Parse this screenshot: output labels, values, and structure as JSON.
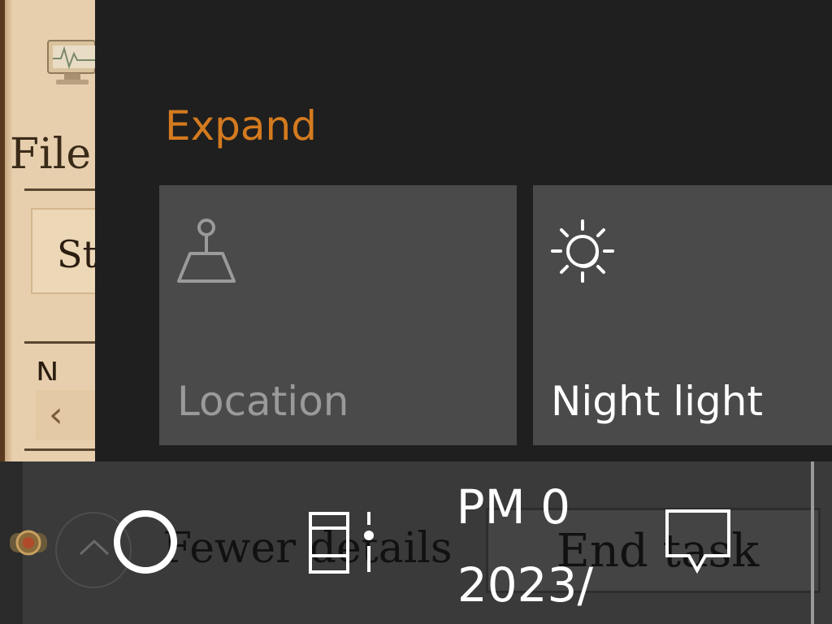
{
  "background_app": {
    "menu_file": "File",
    "tab_label": "St",
    "column_label": "N"
  },
  "action_center": {
    "expand_label": "Expand",
    "tiles": [
      {
        "label": "Location",
        "icon": "location-icon",
        "state": "off"
      },
      {
        "label": "Night light",
        "icon": "night-light-icon",
        "state": "on"
      }
    ]
  },
  "task_manager_footer": {
    "fewer_details_label": "Fewer details",
    "end_task_label": "End task"
  },
  "taskbar": {
    "clock_time": "0 PM",
    "clock_date": "/2023"
  },
  "colors": {
    "accent": "#d47a1f",
    "tile_bg": "#4a4a4a",
    "panel_bg": "#1f1f1f",
    "taskbar_bg": "#3a3a3a"
  }
}
